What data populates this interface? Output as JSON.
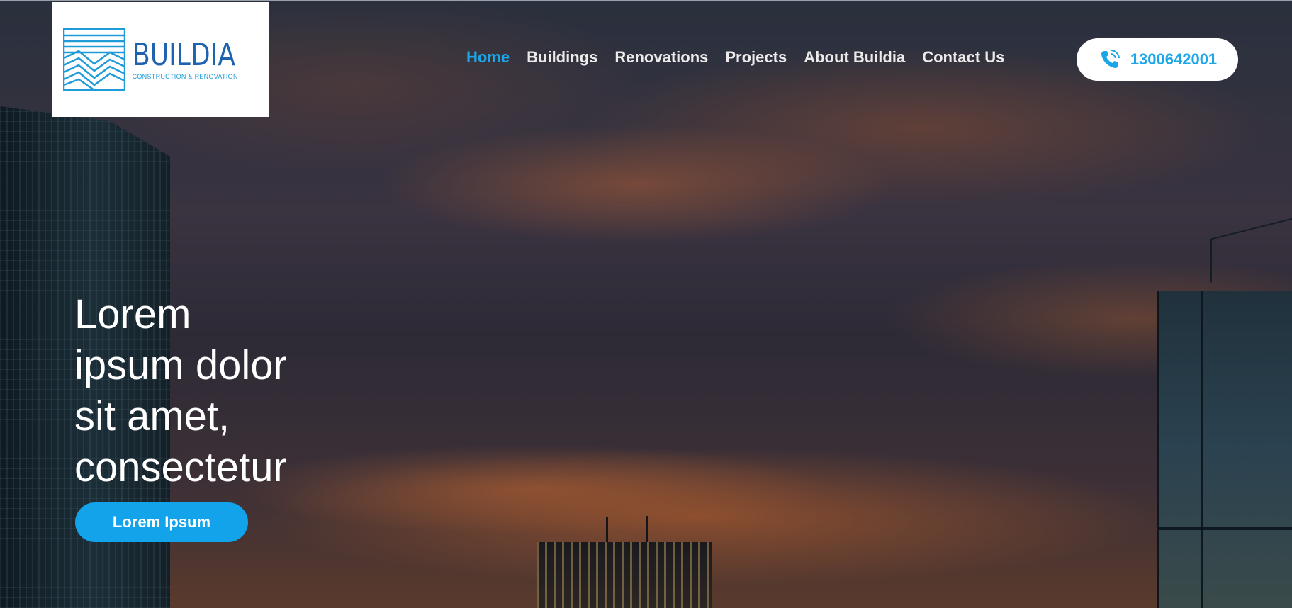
{
  "logo": {
    "title": "BUILDIA",
    "subtitle": "CONSTRUCTION & RENOVATION",
    "icon": "building-lines-logo"
  },
  "nav": {
    "items": [
      {
        "label": "Home",
        "active": true
      },
      {
        "label": "Buildings",
        "active": false
      },
      {
        "label": "Renovations",
        "active": false
      },
      {
        "label": "Projects",
        "active": false
      },
      {
        "label": "About Buildia",
        "active": false
      },
      {
        "label": "Contact Us",
        "active": false
      }
    ]
  },
  "phone": {
    "icon": "phone-ringing-icon",
    "number": "1300642001"
  },
  "hero": {
    "title_lines": [
      "Lorem",
      "ipsum dolor",
      "sit amet,",
      "consectetur"
    ],
    "cta_label": "Lorem Ipsum"
  },
  "colors": {
    "accent": "#1aa6e8",
    "logo_blue": "#1f63b0",
    "nav_text": "#eceaea",
    "cta_bg": "#12a3ea"
  }
}
